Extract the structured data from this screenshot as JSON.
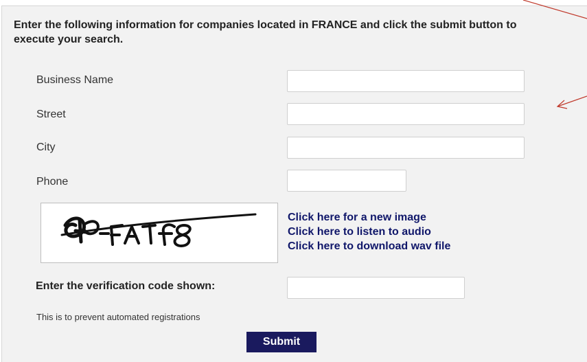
{
  "form": {
    "intro_text": "Enter the following information for companies located in FRANCE and click the submit button to execute your search.",
    "fields": [
      {
        "label": "Business Name",
        "value": "",
        "placeholder": ""
      },
      {
        "label": "Street",
        "value": "",
        "placeholder": ""
      },
      {
        "label": "City",
        "value": "",
        "placeholder": ""
      },
      {
        "label": "Phone",
        "value": "",
        "placeholder": ""
      }
    ],
    "captcha": {
      "image_alt": "CAPTCHA code",
      "new_image_link": "Click here for a new image",
      "listen_audio_link": "Click here to listen to audio",
      "download_wav_link": "Click here to download wav file"
    },
    "verification_label": "Enter the verification code shown:",
    "verification_value": "",
    "note": "This is to prevent automated registrations",
    "submit_label": "Submit"
  },
  "colors": {
    "panel_background": "#f2f2f2",
    "link": "#10176a",
    "submit_background": "#1a1a5e",
    "annotation_arrow": "#c0392b"
  }
}
